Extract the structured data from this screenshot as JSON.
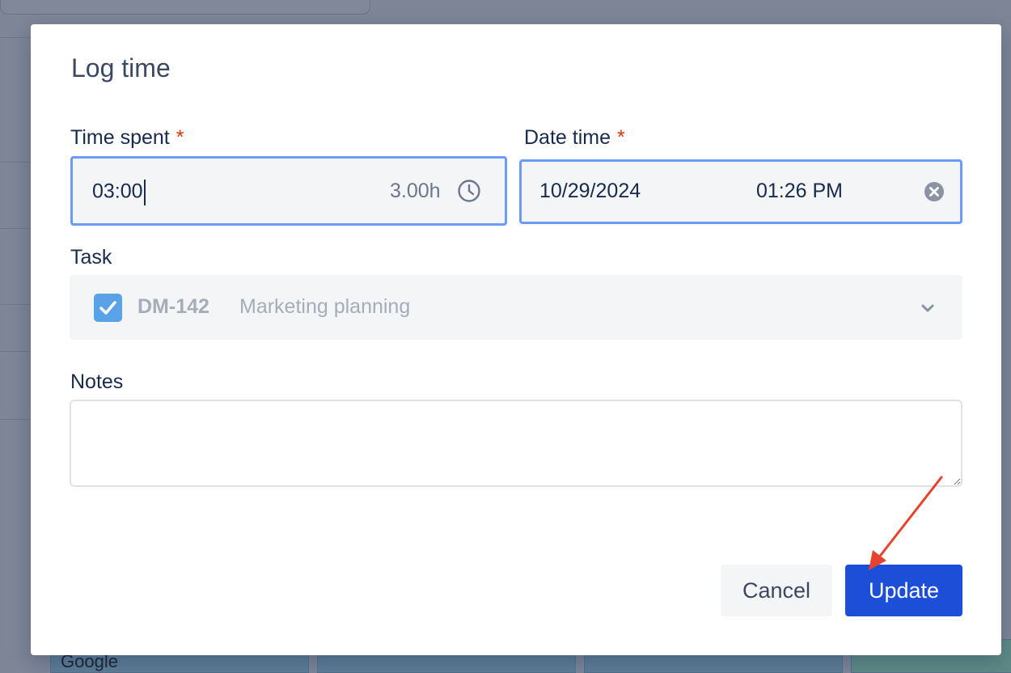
{
  "background": {
    "tile_label": "Google"
  },
  "dialog": {
    "title": "Log time",
    "time_spent": {
      "label": "Time spent",
      "required_mark": "*",
      "value": "03:00",
      "hours": "3.00h",
      "icon": "clock-icon"
    },
    "date_time": {
      "label": "Date time",
      "required_mark": "*",
      "date": "10/29/2024",
      "time": "01:26 PM",
      "icon": "clear-icon"
    },
    "task": {
      "label": "Task",
      "key": "DM-142",
      "name": "Marketing planning",
      "checked": true,
      "icon": "chevron-down-icon"
    },
    "notes": {
      "label": "Notes",
      "value": ""
    },
    "buttons": {
      "cancel": "Cancel",
      "update": "Update"
    }
  },
  "colors": {
    "primary": "#1d4ed8",
    "focus_border": "#6c9bf5",
    "required": "#de350b",
    "checkbox": "#5aa2e8",
    "annotation_arrow": "#e5432f"
  }
}
